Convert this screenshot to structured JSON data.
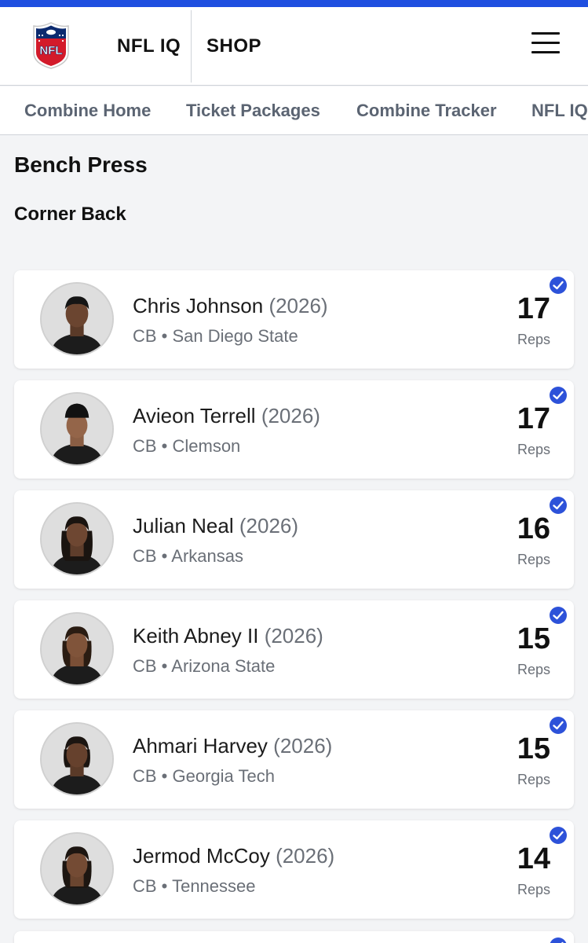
{
  "header": {
    "logo_text": "NFL",
    "nav_iq": "NFL IQ",
    "nav_shop": "SHOP",
    "accent_color": "#1f4fe0"
  },
  "subnav": {
    "items": [
      "Combine Home",
      "Ticket Packages",
      "Combine Tracker",
      "NFL IQ"
    ]
  },
  "page": {
    "title": "Bench Press",
    "position_group": "Corner Back"
  },
  "players": [
    {
      "name": "Chris Johnson",
      "year": "(2026)",
      "meta": "CB • San Diego State",
      "reps": "17",
      "reps_label": "Reps"
    },
    {
      "name": "Avieon Terrell",
      "year": "(2026)",
      "meta": "CB • Clemson",
      "reps": "17",
      "reps_label": "Reps"
    },
    {
      "name": "Julian Neal",
      "year": "(2026)",
      "meta": "CB • Arkansas",
      "reps": "16",
      "reps_label": "Reps"
    },
    {
      "name": "Keith Abney II",
      "year": "(2026)",
      "meta": "CB • Arizona State",
      "reps": "15",
      "reps_label": "Reps"
    },
    {
      "name": "Ahmari Harvey",
      "year": "(2026)",
      "meta": "CB • Georgia Tech",
      "reps": "15",
      "reps_label": "Reps"
    },
    {
      "name": "Jermod McCoy",
      "year": "(2026)",
      "meta": "CB • Tennessee",
      "reps": "14",
      "reps_label": "Reps"
    }
  ],
  "icons": {
    "verified": "check-badge-icon",
    "menu": "hamburger-menu-icon",
    "logo": "nfl-shield-logo"
  },
  "colors": {
    "verified_badge": "#2d52d9",
    "muted_text": "#6a6f77"
  }
}
